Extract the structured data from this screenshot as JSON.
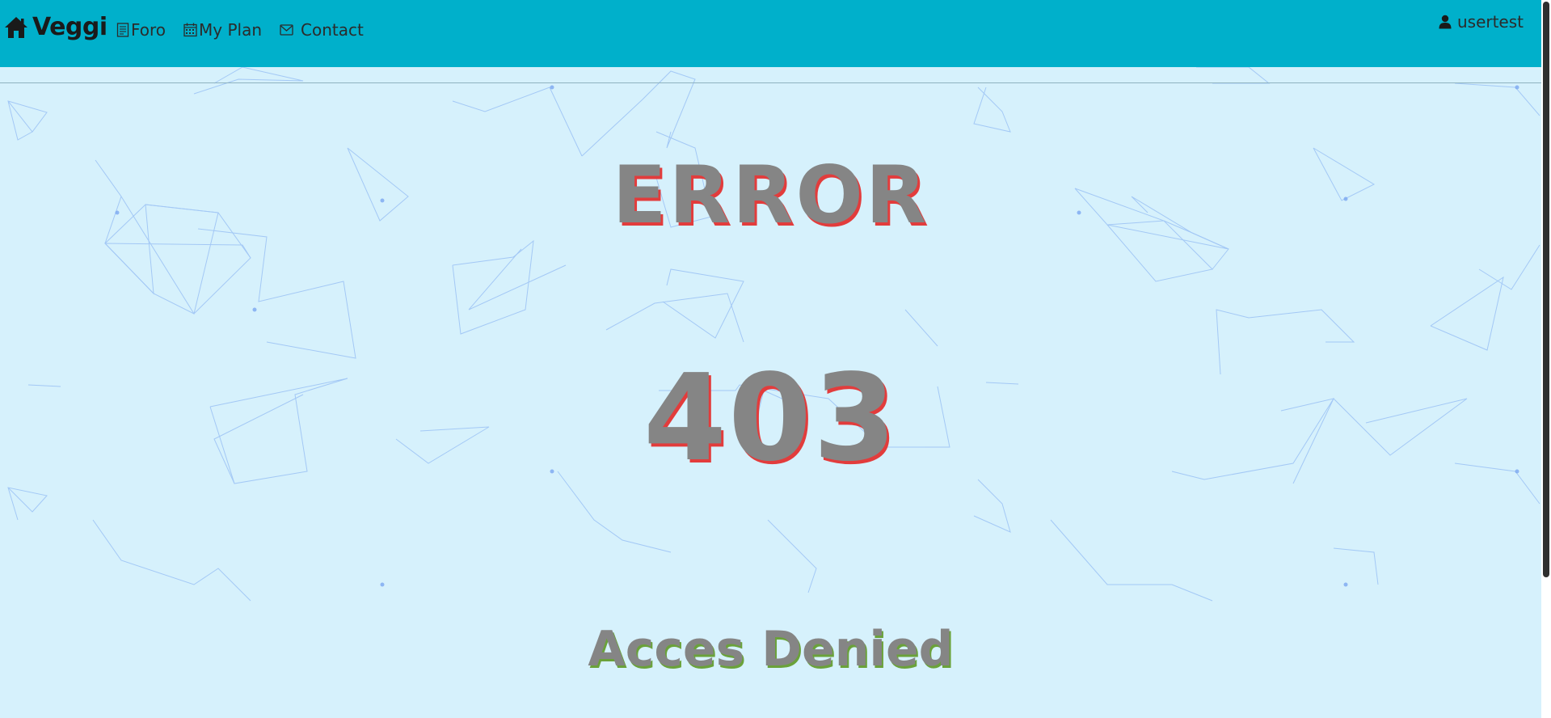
{
  "navbar": {
    "brand_label": "Veggi",
    "links": [
      {
        "label": "Foro",
        "icon": "document-icon"
      },
      {
        "label": "My Plan",
        "icon": "calendar-icon"
      },
      {
        "label": "Contact",
        "icon": "envelope-icon"
      }
    ],
    "user_label": "usertest",
    "colors": {
      "background": "#00b0cb"
    }
  },
  "error": {
    "title": "ERROR",
    "code": "403",
    "message": "Acces Denied",
    "colors": {
      "text": "#858585",
      "shadow": "#e23c3c",
      "message_shadow": "#6aa23a"
    }
  },
  "page": {
    "colors": {
      "background": "#d6f1fc",
      "network_lines": "#7aa7f0"
    }
  }
}
